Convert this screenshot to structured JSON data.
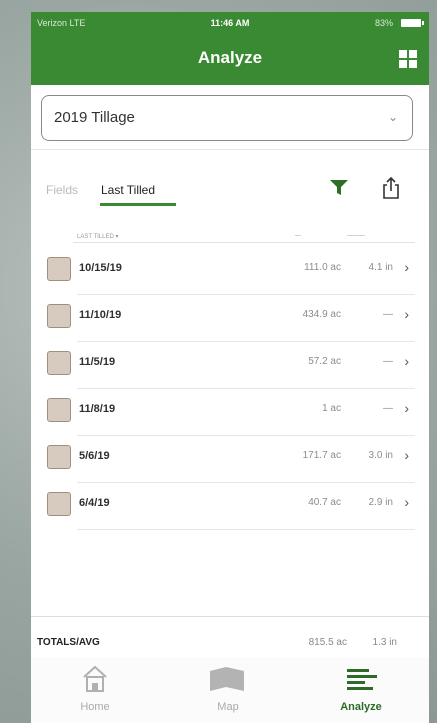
{
  "status_bar": {
    "carrier": "Verizon  LTE",
    "time": "11:46 AM",
    "battery": "83%"
  },
  "header": {
    "title": "Analyze",
    "grid_icon": "grid-icon"
  },
  "selector": {
    "value": "2019 Tillage",
    "chevron": "chevron-down-icon"
  },
  "tabs": {
    "fields": "Fields",
    "last_tilled": "Last Tilled",
    "active": "last_tilled"
  },
  "columns": {
    "date_header": "LAST TILLED ▾",
    "area_header": "—",
    "value_header": "———"
  },
  "rows": [
    {
      "date": "10/15/19",
      "area": "111.0 ac",
      "value": "4.1 in"
    },
    {
      "date": "11/10/19",
      "area": "434.9 ac",
      "value": "—"
    },
    {
      "date": "11/5/19",
      "area": "57.2 ac",
      "value": "—"
    },
    {
      "date": "11/8/19",
      "area": "1 ac",
      "value": "—"
    },
    {
      "date": "5/6/19",
      "area": "171.7 ac",
      "value": "3.0 in"
    },
    {
      "date": "6/4/19",
      "area": "40.7 ac",
      "value": "2.9 in"
    }
  ],
  "totals": {
    "label": "TOTALS/AVG",
    "area": "815.5 ac",
    "value": "1.3 in"
  },
  "tabbar": {
    "home": "Home",
    "map": "Map",
    "analyze": "Analyze"
  },
  "colors": {
    "brand_green": "#3a8a34",
    "swatch_fill": "#d7cbbf"
  }
}
